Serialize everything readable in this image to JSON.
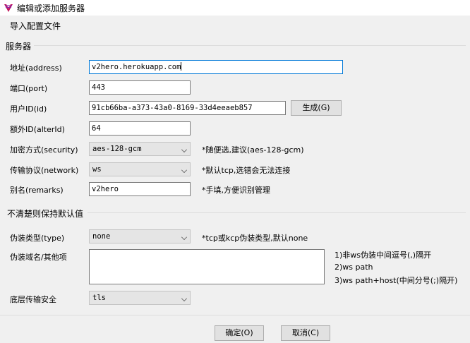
{
  "window": {
    "title": "编辑或添加服务器"
  },
  "menu": {
    "import_label": "导入配置文件"
  },
  "server_section": {
    "title": "服务器",
    "address": {
      "label": "地址(address)",
      "value": "v2hero.herokuapp.com"
    },
    "port": {
      "label": "端口(port)",
      "value": "443"
    },
    "id": {
      "label": "用户ID(id)",
      "value": "91cb66ba-a373-43a0-8169-33d4eeaeb857",
      "generate_label": "生成(G)"
    },
    "alter_id": {
      "label": "额外ID(alterId)",
      "value": "64"
    },
    "security": {
      "label": "加密方式(security)",
      "value": "aes-128-gcm",
      "hint": "*随便选,建议(aes-128-gcm)"
    },
    "network": {
      "label": "传输协议(network)",
      "value": "ws",
      "hint": "*默认tcp,选错会无法连接"
    },
    "remarks": {
      "label": "别名(remarks)",
      "value": "v2hero",
      "hint": "*手填,方便识别管理"
    }
  },
  "default_section": {
    "title": "不清楚则保持默认值",
    "type": {
      "label": "伪装类型(type)",
      "value": "none",
      "hint": "*tcp或kcp伪装类型,默认none"
    },
    "host": {
      "label": "伪装域名/其他项",
      "value": "",
      "hints": [
        "1)非ws伪装中间逗号(,)隔开",
        "2)ws path",
        "3)ws path+host(中间分号(;)隔开)"
      ]
    },
    "tls": {
      "label": "底层传输安全",
      "value": "tls"
    }
  },
  "footer": {
    "ok_label": "确定(O)",
    "cancel_label": "取消(C)"
  }
}
